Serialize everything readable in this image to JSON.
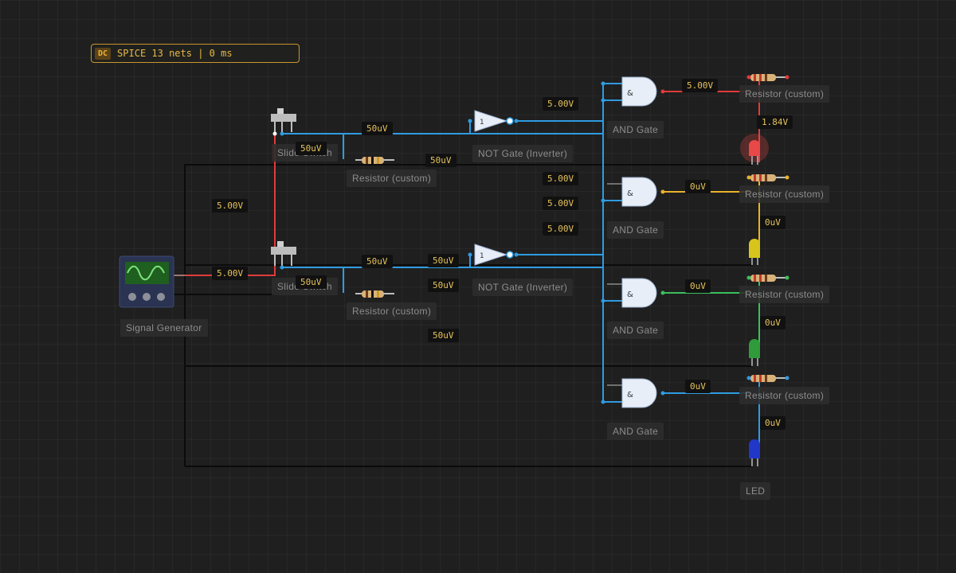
{
  "status": {
    "mode": "DC",
    "text": "SPICE 13 nets | 0 ms"
  },
  "components": {
    "signal_generator": "Signal Generator",
    "slide_switch": "Slide Switch",
    "resistor": "Resistor (custom)",
    "not_gate": "NOT Gate (Inverter)",
    "and_gate": "AND Gate",
    "led": "LED",
    "and_symbol": "&",
    "not_symbol": "1"
  },
  "readings": {
    "and1_out": "5.00V",
    "not1_out": "5.00V",
    "led_red": "1.84V",
    "sw1_a": "50uV",
    "sw1_b": "50uV",
    "wire_top": "50uV",
    "and2_in_a": "5.00V",
    "and2_in_b": "5.00V",
    "and2_in_c": "5.00V",
    "and2_out": "0uV",
    "led_yellow": "0uV",
    "src": "5.00V",
    "gen_out": "5.00V",
    "sw2_a": "50uV",
    "sw2_b": "50uV",
    "not2_in": "50uV",
    "wire_mid": "50uV",
    "wire_low": "50uV",
    "and3_out": "0uV",
    "led_green": "0uV",
    "and4_out": "0uV",
    "led_blue": "0uV"
  },
  "colors": {
    "red": "#e03b3b",
    "blue": "#2f9be0",
    "yellow": "#e8b22a",
    "green": "#3bbf5c",
    "navy": "#2255d8",
    "black_wire": "#0b0b0b",
    "accent": "#c9952f"
  }
}
